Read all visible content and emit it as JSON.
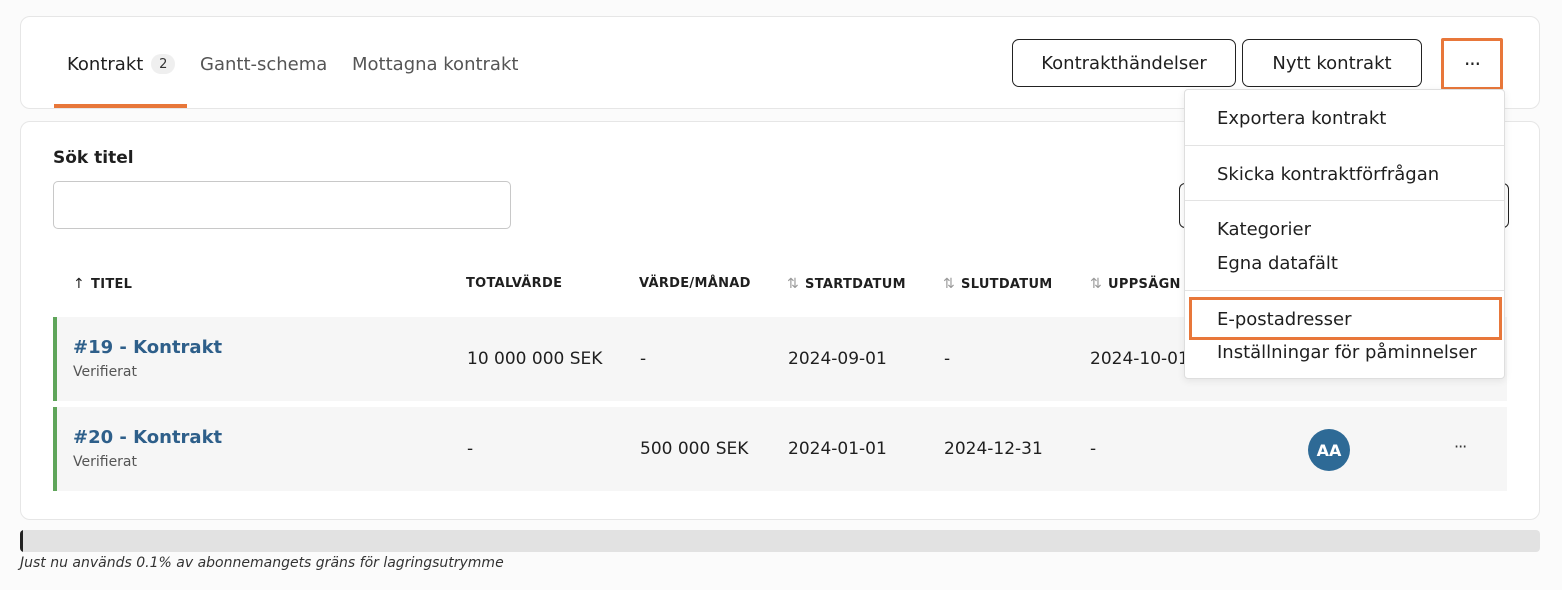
{
  "tabs": [
    {
      "label": "Kontrakt",
      "count": "2"
    },
    {
      "label": "Gantt-schema"
    },
    {
      "label": "Mottagna kontrakt"
    }
  ],
  "toolbar": {
    "events_label": "Kontrakthändelser",
    "new_label": "Nytt kontrakt",
    "more_label": "···"
  },
  "search": {
    "label": "Sök titel",
    "value": "",
    "placeholder": ""
  },
  "columns": {
    "title": "TITEL",
    "total": "TOTALVÄRDE",
    "monthly": "VÄRDE/MÅNAD",
    "start": "STARTDATUM",
    "end": "SLUTDATUM",
    "notice": "UPPSÄGN"
  },
  "sort_icons": {
    "asc": "↑",
    "both": "⇅"
  },
  "rows": [
    {
      "title": "#19 - Kontrakt",
      "status": "Verifierat",
      "total": "10 000 000 SEK",
      "monthly": "-",
      "start": "2024-09-01",
      "end": "-",
      "notice": "2024-10-01",
      "avatar": ""
    },
    {
      "title": "#20 - Kontrakt",
      "status": "Verifierat",
      "total": "-",
      "monthly": "500 000 SEK",
      "start": "2024-01-01",
      "end": "2024-12-31",
      "notice": "-",
      "avatar": "AA",
      "more": "···"
    }
  ],
  "menu": {
    "items": [
      "Exportera kontrakt",
      "Skicka kontraktförfrågan",
      "Kategorier",
      "Egna datafält",
      "E-postadresser",
      "Inställningar för påminnelser"
    ]
  },
  "storage": {
    "used_fraction": 0.001,
    "text": "Just nu används 0.1% av abonnemangets gräns för lagringsutrymme"
  },
  "colors": {
    "accent": "#e8773a",
    "link": "#2e5f8a",
    "verified": "#5fa55a",
    "avatar": "#2e6a96"
  }
}
